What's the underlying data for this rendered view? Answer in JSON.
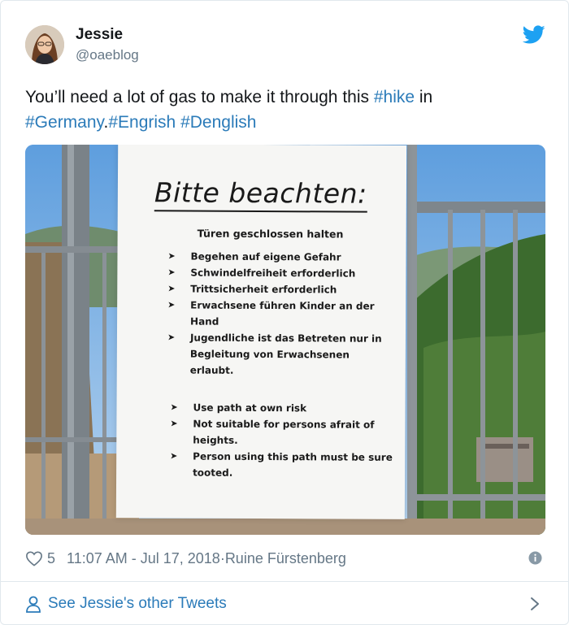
{
  "author": {
    "name": "Jessie",
    "handle": "@oaeblog"
  },
  "tweet": {
    "text_plain": "You’ll need a lot of gas to make it through this ",
    "hashtag_hike": "#hike",
    "text_in": " in",
    "hashtag_germany": "#Germany",
    "dot": ".",
    "hashtag_engrish": "#Engrish",
    "space": " ",
    "hashtag_denglish": "#Denglish"
  },
  "photo": {
    "sign": {
      "title": "Bitte beachten:",
      "subtitle": "Türen geschlossen halten",
      "bullet": "➤",
      "german_items": [
        "Begehen auf eigene Gefahr",
        "Schwindelfreiheit erforderlich",
        "Trittsicherheit erforderlich",
        "Erwachsene führen Kinder an der Hand",
        "Jugendliche ist das Betreten nur in Begleitung von Erwachsenen erlaubt."
      ],
      "english_items": [
        "Use path at own risk",
        "Not suitable for persons afrait of heights.",
        "Person using this path must be sure tooted."
      ]
    }
  },
  "meta": {
    "likes": "5",
    "timestamp": "11:07 AM - Jul 17, 2018",
    "separator": " · ",
    "location": "Ruine Fürstenberg"
  },
  "footer": {
    "link_label": "See Jessie's other Tweets"
  },
  "colors": {
    "link": "#2b7bb9",
    "muted": "#657786",
    "text": "#14171a",
    "twitter_blue": "#1da1f2"
  },
  "icons": {
    "bird": "twitter-bird-icon",
    "heart": "heart-icon",
    "info": "info-icon",
    "person": "person-icon",
    "chevron": "chevron-right-icon"
  }
}
